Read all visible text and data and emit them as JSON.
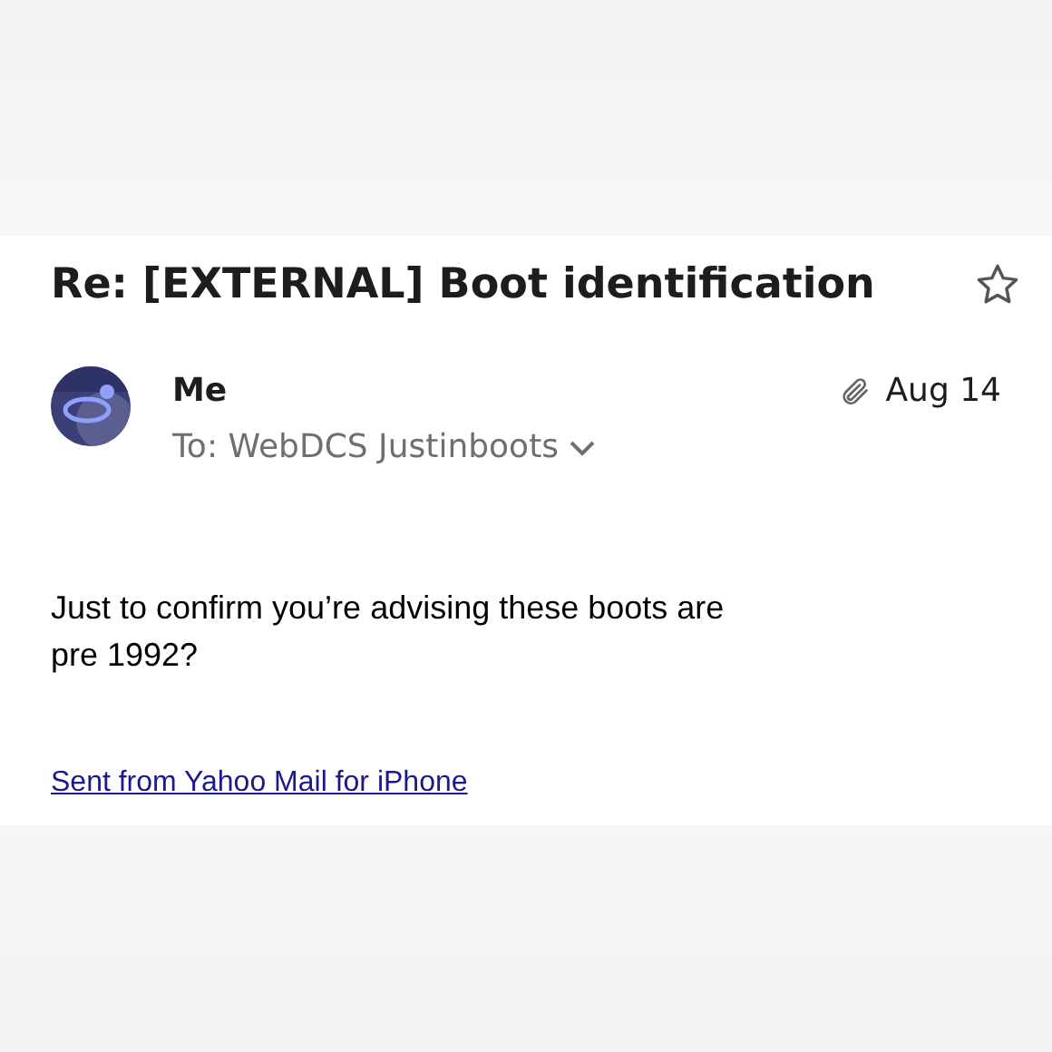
{
  "email": {
    "subject": "Re: [EXTERNAL] Boot identification",
    "starred": false,
    "sender": "Me",
    "recipients": "To: WebDCS Justinboots",
    "has_attachment": true,
    "date": "Aug 14",
    "body": [
      "Just to confirm you’re advising these boots are pre 1992?"
    ],
    "signature_link": "Sent from Yahoo Mail for iPhone"
  }
}
